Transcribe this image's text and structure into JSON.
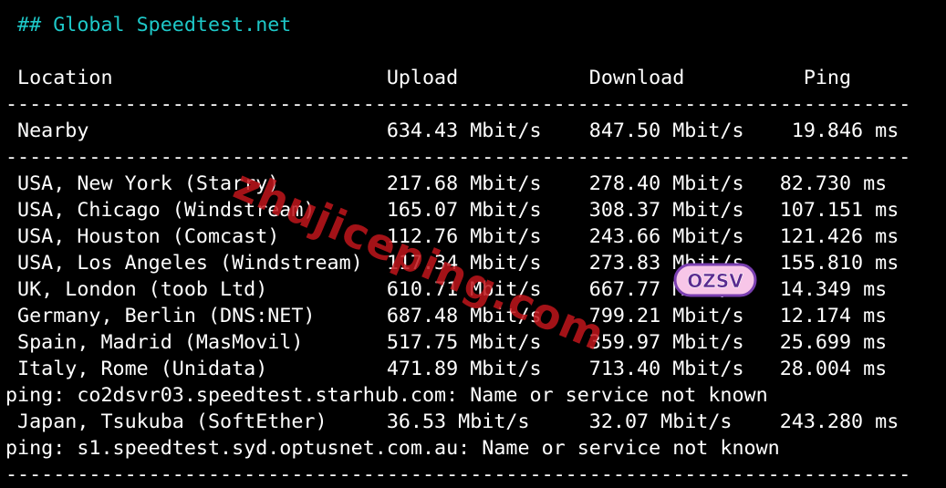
{
  "terminal": {
    "heading": " ## Global Speedtest.net",
    "header_row": " Location                       Upload           Download          Ping",
    "separator": "----------------------------------------------------------------------------",
    "rows": [
      " Nearby                         634.43 Mbit/s    847.50 Mbit/s    19.846 ms",
      " USA, New York (Starry)         217.68 Mbit/s    278.40 Mbit/s   82.730 ms",
      " USA, Chicago (Windstream)      165.07 Mbit/s    308.37 Mbit/s   107.151 ms",
      " USA, Houston (Comcast)         112.76 Mbit/s    243.66 Mbit/s   121.426 ms",
      " USA, Los Angeles (Windstream)  117.34 Mbit/s    273.83 Mbit/s   155.810 ms",
      " UK, London (toob Ltd)          610.71 Mbit/s    667.77 Mbit/s   14.349 ms",
      " Germany, Berlin (DNS:NET)      687.48 Mbit/s    799.21 Mbit/s   12.174 ms",
      " Spain, Madrid (MasMovil)       517.75 Mbit/s    359.97 Mbit/s   25.699 ms",
      " Italy, Rome (Unidata)          471.89 Mbit/s    713.40 Mbit/s   28.004 ms",
      "ping: co2dsvr03.speedtest.starhub.com: Name or service not known",
      " Japan, Tsukuba (SoftEther)     36.53 Mbit/s     32.07 Mbit/s    243.280 ms",
      "ping: s1.speedtest.syd.optusnet.com.au: Name or service not known"
    ]
  },
  "watermark": {
    "text": "zhujiceping.com",
    "logo_text": "OZSV"
  },
  "colors": {
    "background": "#000000",
    "text": "#ffffff",
    "heading": "#1ec8c8",
    "watermark": "#c0161c"
  }
}
